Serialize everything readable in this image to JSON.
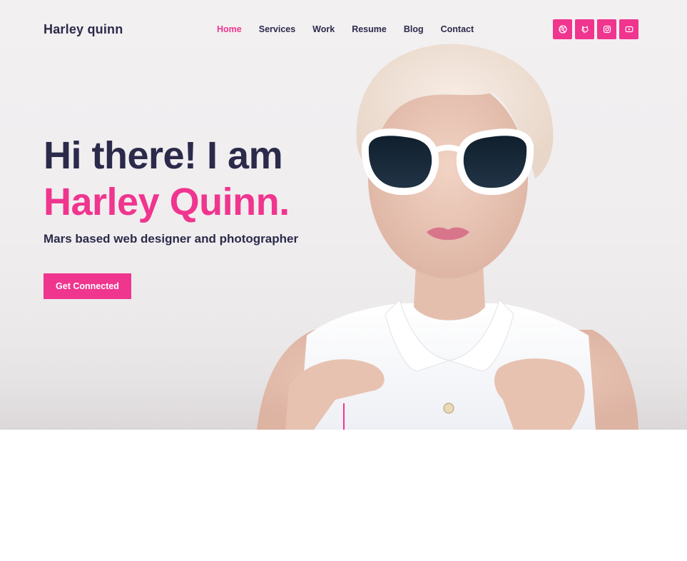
{
  "header": {
    "logo": "Harley quinn",
    "nav": [
      "Home",
      "Services",
      "Work",
      "Resume",
      "Blog",
      "Contact"
    ],
    "active_nav": "Home",
    "socials": [
      "dribbble-icon",
      "github-icon",
      "instagram-icon",
      "youtube-icon"
    ]
  },
  "hero": {
    "greeting": "Hi there! I am",
    "name": "Harley Quinn.",
    "tagline": "Mars based web designer and photographer",
    "cta_label": "Get Connected"
  },
  "colors": {
    "accent": "#f0358f",
    "text_dark": "#2c2a4a",
    "background": "#efedee"
  }
}
